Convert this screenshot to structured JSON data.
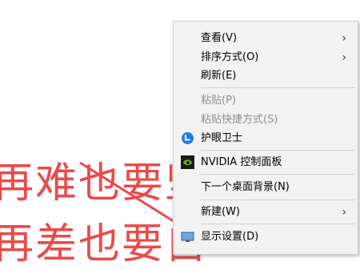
{
  "background": {
    "line1": "再难也要坚",
    "line2": "再差也要自"
  },
  "menu": {
    "items": [
      {
        "label": "查看(V)",
        "has_submenu": true,
        "enabled": true
      },
      {
        "label": "排序方式(O)",
        "has_submenu": true,
        "enabled": true
      },
      {
        "label": "刷新(E)",
        "has_submenu": false,
        "enabled": true
      },
      {
        "label": "粘贴(P)",
        "has_submenu": false,
        "enabled": false
      },
      {
        "label": "粘贴快捷方式(S)",
        "has_submenu": false,
        "enabled": false
      },
      {
        "label": "护眼卫士",
        "has_submenu": false,
        "enabled": true,
        "icon": "eye-guard-icon"
      },
      {
        "label": "NVIDIA 控制面板",
        "has_submenu": false,
        "enabled": true,
        "icon": "nvidia-icon"
      },
      {
        "label": "下一个桌面背景(N)",
        "has_submenu": false,
        "enabled": true
      },
      {
        "label": "新建(W)",
        "has_submenu": true,
        "enabled": true
      },
      {
        "label": "显示设置(D)",
        "has_submenu": false,
        "enabled": true,
        "icon": "display-settings-icon"
      }
    ]
  },
  "colors": {
    "annotation_red": "#e84b4b",
    "menu_bg": "#f2f2f2",
    "eye_guard_blue": "#1e7bef",
    "nvidia_green": "#76b900"
  }
}
